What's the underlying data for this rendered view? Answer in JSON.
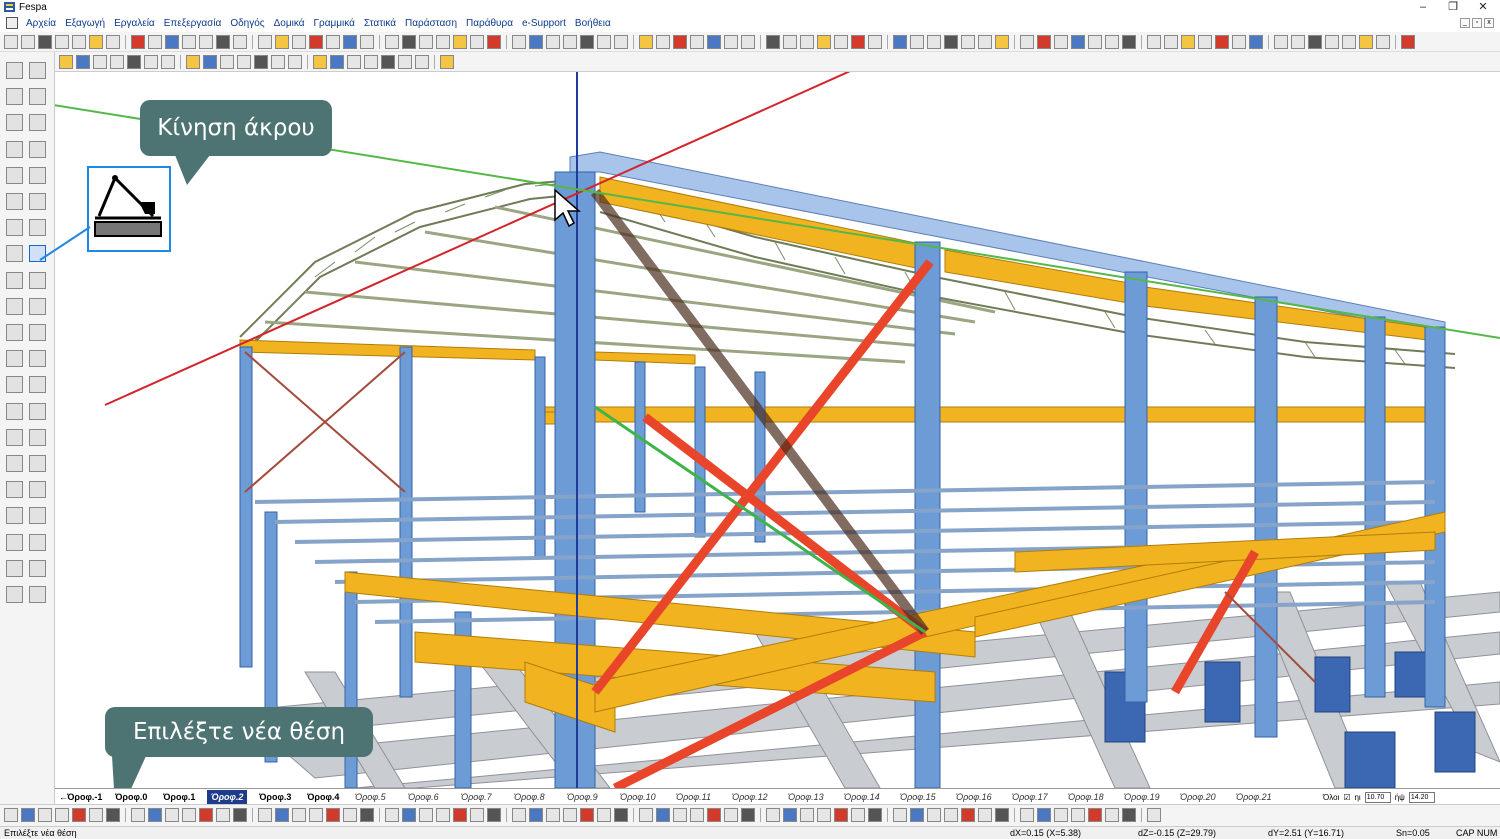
{
  "window": {
    "title": "Fespa"
  },
  "menu": [
    "Αρχεία",
    "Εξαγωγή",
    "Εργαλεία",
    "Επεξεργασία",
    "Οδηγός",
    "Δομικά",
    "Γραμμικά",
    "Στατικά",
    "Παράσταση",
    "Παράθυρα",
    "e-Support",
    "Βοήθεια"
  ],
  "callouts": {
    "top": "Κίνηση άκρου",
    "bottom": "Επιλέξτε νέα θέση"
  },
  "floors": [
    "Όροφ.-1",
    "Όροφ.0",
    "Όροφ.1",
    "Όροφ.2",
    "Όροφ.3",
    "Όροφ.4",
    "Όροφ.5",
    "Όροφ.6",
    "Όροφ.7",
    "Όροφ.8",
    "Όροφ.9",
    "Όροφ.10",
    "Όροφ.11",
    "Όροφ.12",
    "Όροφ.13",
    "Όροφ.14",
    "Όροφ.15",
    "Όροφ.16",
    "Όροφ.17",
    "Όροφ.18",
    "Όροφ.19",
    "Όροφ.20",
    "Όροφ.21"
  ],
  "active_floor": "Όροφ.2",
  "floor_extra": {
    "all_label": "Όλοι",
    "h_label": "ηι",
    "h_val": "10.70",
    "elev_label": "ήψ",
    "elev_val": "14.20"
  },
  "status": {
    "message": "Επιλέξτε νέα θέση",
    "dx": "dX=0.15 (X=5.38)",
    "dz": "dZ=-0.15 (Z=29.79)",
    "dy": "dY=2.51 (Y=16.71)",
    "snap": "Sn=0.05",
    "caps": "CAP  NUM"
  },
  "colors": {
    "columns": "#6c9bd6",
    "beams": "#f2b320",
    "bracing": "#e8452a",
    "truss": "#7c8a66",
    "foundation": "#c9ccd1",
    "callout": "#4d7473"
  }
}
